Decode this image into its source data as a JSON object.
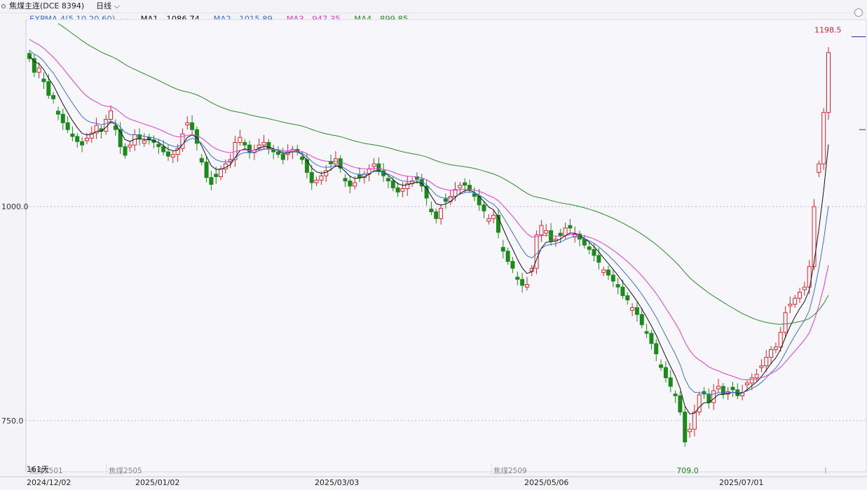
{
  "header": {
    "title": "焦煤主连(DCE 8394)",
    "period": "日线",
    "dropdown_icon": "chevron-down-icon"
  },
  "indicator": {
    "name": "EXPMA-4(5,10,20,60)",
    "ma1": {
      "label": "MA1",
      "value": "1086.74",
      "color": "#111111"
    },
    "ma2": {
      "label": "MA2",
      "value": "1015.89",
      "color": "#3a6fd8"
    },
    "ma3": {
      "label": "MA3",
      "value": "947.35",
      "color": "#e03ad8"
    },
    "ma4": {
      "label": "MA4",
      "value": "899.85",
      "color": "#2a8a2a"
    }
  },
  "chart_data": {
    "type": "candlestick",
    "y_ticks": [
      "1000.0",
      "750.0"
    ],
    "ylim": [
      700,
      1212
    ],
    "x_dates": [
      "2024/12/02",
      "2025/01/02",
      "2025/03/03",
      "2025/05/06",
      "2025/07/01"
    ],
    "contract_labels": [
      "焦煤2501",
      "焦煤2505",
      "焦煤2509"
    ],
    "annotations": {
      "high": "1198.5",
      "low": "709.0",
      "bars": "161天"
    },
    "colors": {
      "up": "#d9252a",
      "down": "#1b8a1b"
    },
    "closes": [
      1173,
      1157,
      1162,
      1146,
      1130,
      1126,
      1108,
      1098,
      1090,
      1082,
      1076,
      1072,
      1080,
      1086,
      1095,
      1088,
      1102,
      1112,
      1090,
      1070,
      1060,
      1072,
      1084,
      1080,
      1077,
      1078,
      1075,
      1070,
      1064,
      1059,
      1061,
      1068,
      1085,
      1098,
      1090,
      1074,
      1052,
      1034,
      1026,
      1035,
      1044,
      1050,
      1055,
      1075,
      1081,
      1072,
      1063,
      1066,
      1072,
      1075,
      1068,
      1064,
      1061,
      1055,
      1064,
      1067,
      1064,
      1055,
      1040,
      1028,
      1031,
      1036,
      1042,
      1050,
      1056,
      1045,
      1030,
      1024,
      1028,
      1034,
      1038,
      1044,
      1050,
      1042,
      1036,
      1030,
      1022,
      1017,
      1021,
      1027,
      1030,
      1032,
      1024,
      1010,
      994,
      986,
      998,
      1006,
      1012,
      1020,
      1025,
      1025,
      1020,
      1012,
      1002,
      995,
      986,
      990,
      970,
      948,
      936,
      928,
      915,
      908,
      909,
      928,
      967,
      978,
      972,
      960,
      962,
      966,
      975,
      975,
      968,
      962,
      955,
      950,
      943,
      935,
      926,
      920,
      913,
      906,
      896,
      891,
      882,
      874,
      862,
      852,
      840,
      828,
      812,
      800,
      790,
      779,
      760,
      725,
      740,
      760,
      780,
      781,
      771,
      785,
      790,
      781,
      784,
      786,
      779,
      783,
      794,
      800,
      804,
      814,
      824,
      833,
      836,
      853,
      876,
      886,
      893,
      900,
      906,
      930,
      1000,
      1050,
      1110,
      1180
    ]
  }
}
